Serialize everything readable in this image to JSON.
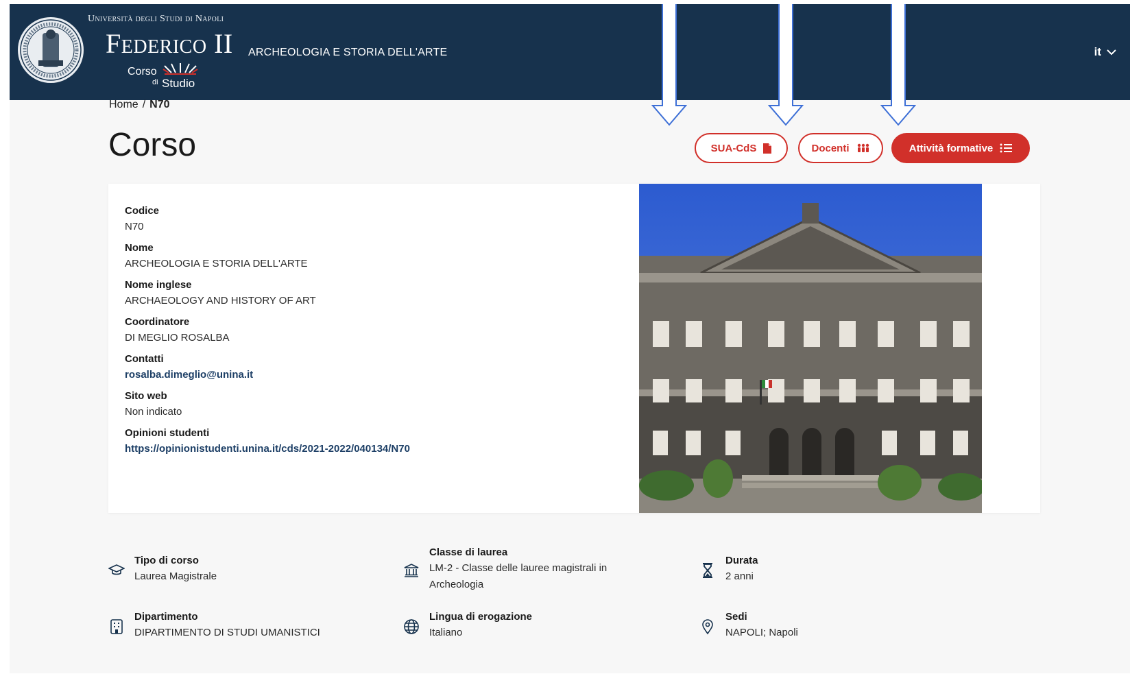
{
  "header": {
    "university": "Università degli Studi di Napoli",
    "university_big": "Federico II",
    "cds_corso": "Corso",
    "cds_di": "di",
    "cds_studio": "Studio",
    "course_title": "ARCHEOLOGIA E STORIA DELL'ARTE",
    "language": "it"
  },
  "breadcrumb": {
    "home": "Home",
    "separator": "/",
    "current": "N70"
  },
  "page": {
    "title": "Corso"
  },
  "actions": {
    "sua_cds": "SUA-CdS",
    "docenti": "Docenti",
    "attivita": "Attività formative"
  },
  "details": [
    {
      "label": "Codice",
      "value": "N70"
    },
    {
      "label": "Nome",
      "value": "ARCHEOLOGIA E STORIA DELL'ARTE"
    },
    {
      "label": "Nome inglese",
      "value": "ARCHAEOLOGY AND HISTORY OF ART"
    },
    {
      "label": "Coordinatore",
      "value": "DI MEGLIO ROSALBA"
    },
    {
      "label": "Contatti",
      "value": "rosalba.dimeglio@unina.it"
    },
    {
      "label": "Sito web",
      "value": "Non indicato"
    },
    {
      "label": "Opinioni studenti",
      "value": "https://opinionistudenti.unina.it/cds/2021-2022/040134/N70"
    }
  ],
  "facts": {
    "tipo": {
      "label": "Tipo di corso",
      "value": "Laurea Magistrale",
      "icon": "graduation-cap-icon"
    },
    "classe": {
      "label": "Classe di laurea",
      "value1": "LM-2 - Classe delle lauree magistrali in",
      "value2": "Archeologia",
      "icon": "institution-icon"
    },
    "durata": {
      "label": "Durata",
      "value": "2 anni",
      "icon": "hourglass-icon"
    },
    "dipartimento": {
      "label": "Dipartimento",
      "value": "DIPARTIMENTO DI STUDI UMANISTICI",
      "icon": "building-icon"
    },
    "lingua": {
      "label": "Lingua di erogazione",
      "value": "Italiano",
      "icon": "globe-icon"
    },
    "sedi": {
      "label": "Sedi",
      "value": "NAPOLI; Napoli",
      "icon": "location-pin-icon"
    }
  },
  "colors": {
    "header_bg": "#17324d",
    "accent": "#d1302a",
    "link": "#1d3f66",
    "arrow": "#3d6fd6"
  }
}
